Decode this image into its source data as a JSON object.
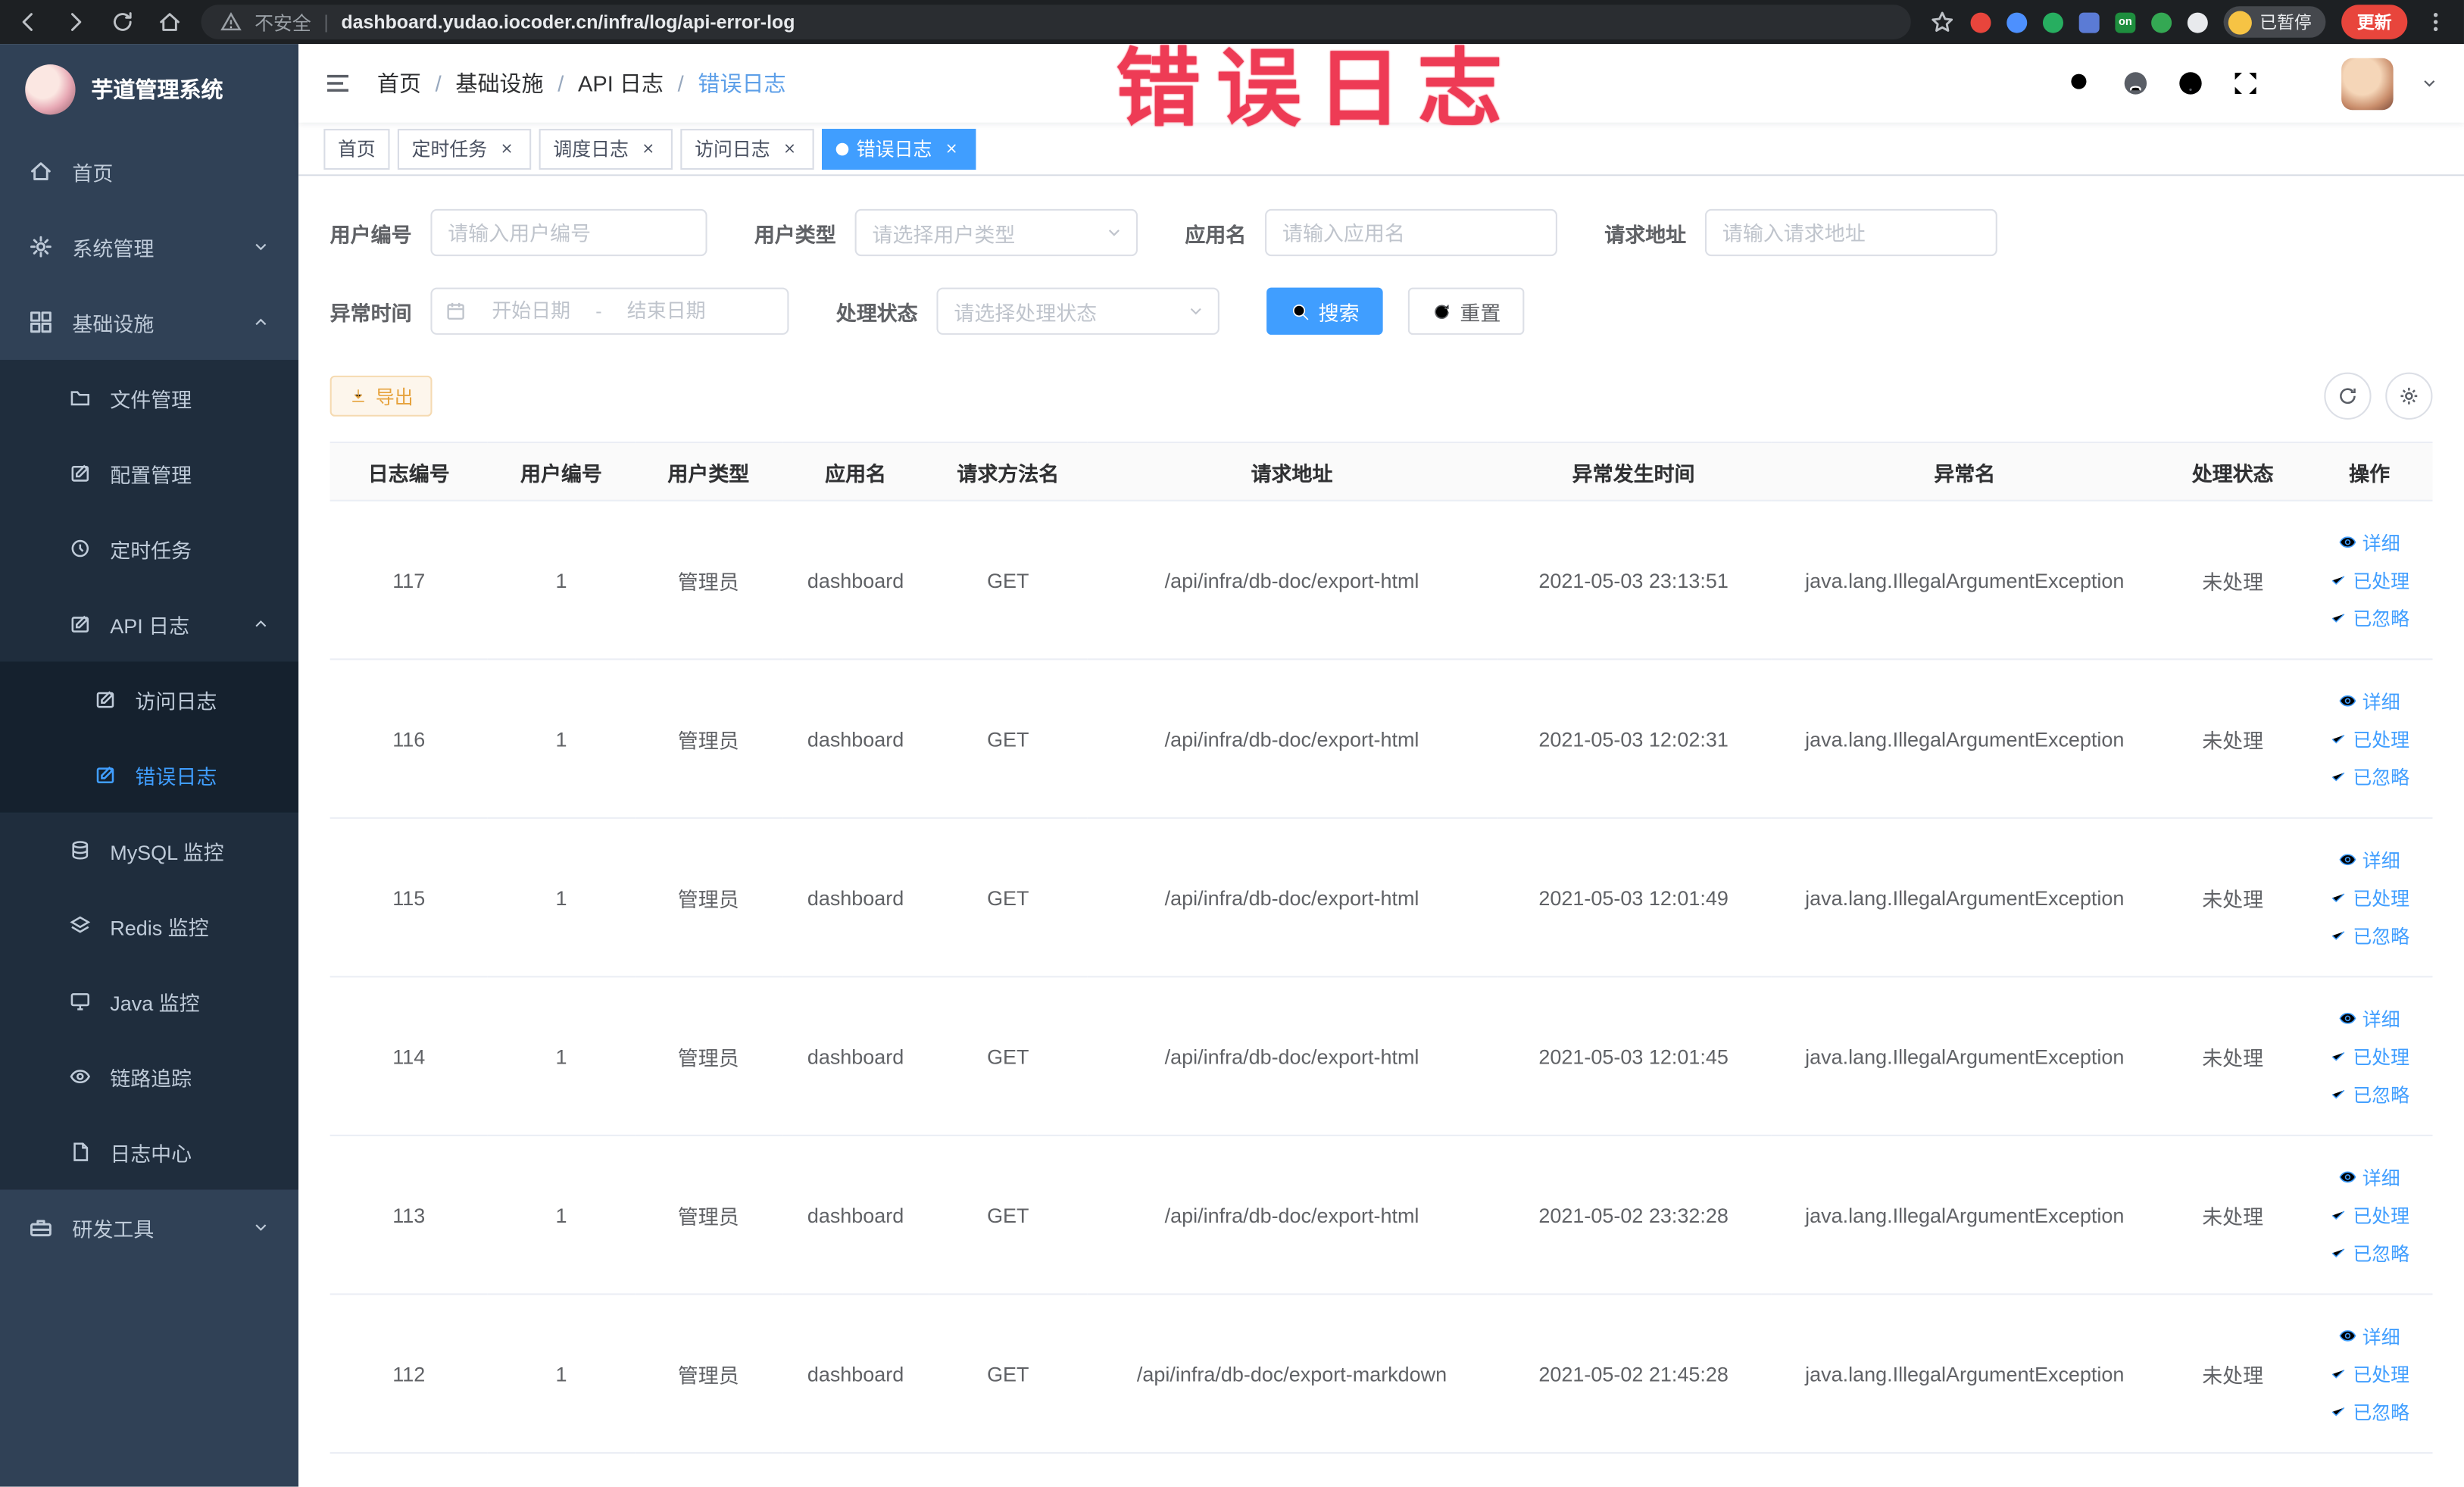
{
  "browser": {
    "security_label": "不安全",
    "url": "dashboard.yudao.iocoder.cn/infra/log/api-error-log",
    "on_badge": "on",
    "paused_badge": "已暂停",
    "update_button": "更新"
  },
  "annotation": {
    "text": "错误日志"
  },
  "sidebar": {
    "logo_title": "芋道管理系统",
    "items": {
      "home": "首页",
      "system": "系统管理",
      "infra": "基础设施",
      "dev_tools": "研发工具"
    },
    "infra_children": {
      "file": "文件管理",
      "config": "配置管理",
      "job": "定时任务",
      "api_log": "API 日志",
      "mysql": "MySQL 监控",
      "redis": "Redis 监控",
      "java": "Java 监控",
      "trace": "链路追踪",
      "log_center": "日志中心"
    },
    "api_log_children": {
      "access_log": "访问日志",
      "error_log": "错误日志"
    }
  },
  "navbar": {
    "breadcrumb": [
      "首页",
      "基础设施",
      "API 日志",
      "错误日志"
    ]
  },
  "tabs": [
    {
      "label": "首页"
    },
    {
      "label": "定时任务"
    },
    {
      "label": "调度日志"
    },
    {
      "label": "访问日志"
    },
    {
      "label": "错误日志"
    }
  ],
  "filters": {
    "user_id": {
      "label": "用户编号",
      "placeholder": "请输入用户编号",
      "value": ""
    },
    "user_type": {
      "label": "用户类型",
      "placeholder": "请选择用户类型"
    },
    "app_name": {
      "label": "应用名",
      "placeholder": "请输入应用名",
      "value": ""
    },
    "request_url": {
      "label": "请求地址",
      "placeholder": "请输入请求地址",
      "value": ""
    },
    "exception_time": {
      "label": "异常时间",
      "start_placeholder": "开始日期",
      "separator": "-",
      "end_placeholder": "结束日期"
    },
    "process_status": {
      "label": "处理状态",
      "placeholder": "请选择处理状态"
    },
    "search_button": "搜索",
    "reset_button": "重置"
  },
  "toolbar": {
    "export_label": "导出"
  },
  "table": {
    "columns": [
      "日志编号",
      "用户编号",
      "用户类型",
      "应用名",
      "请求方法名",
      "请求地址",
      "异常发生时间",
      "异常名",
      "处理状态",
      "操作"
    ],
    "row_actions": [
      "详细",
      "已处理",
      "已忽略"
    ],
    "rows": [
      {
        "cells": [
          "117",
          "1",
          "管理员",
          "dashboard",
          "GET",
          "/api/infra/db-doc/export-html",
          "2021-05-03 23:13:51",
          "java.lang.IllegalArgumentException",
          "未处理"
        ]
      },
      {
        "cells": [
          "116",
          "1",
          "管理员",
          "dashboard",
          "GET",
          "/api/infra/db-doc/export-html",
          "2021-05-03 12:02:31",
          "java.lang.IllegalArgumentException",
          "未处理"
        ]
      },
      {
        "cells": [
          "115",
          "1",
          "管理员",
          "dashboard",
          "GET",
          "/api/infra/db-doc/export-html",
          "2021-05-03 12:01:49",
          "java.lang.IllegalArgumentException",
          "未处理"
        ]
      },
      {
        "cells": [
          "114",
          "1",
          "管理员",
          "dashboard",
          "GET",
          "/api/infra/db-doc/export-html",
          "2021-05-03 12:01:45",
          "java.lang.IllegalArgumentException",
          "未处理"
        ]
      },
      {
        "cells": [
          "113",
          "1",
          "管理员",
          "dashboard",
          "GET",
          "/api/infra/db-doc/export-html",
          "2021-05-02 23:32:28",
          "java.lang.IllegalArgumentException",
          "未处理"
        ]
      },
      {
        "cells": [
          "112",
          "1",
          "管理员",
          "dashboard",
          "GET",
          "/api/infra/db-doc/export-markdown",
          "2021-05-02 21:45:28",
          "java.lang.IllegalArgumentException",
          "未处理"
        ]
      }
    ]
  }
}
